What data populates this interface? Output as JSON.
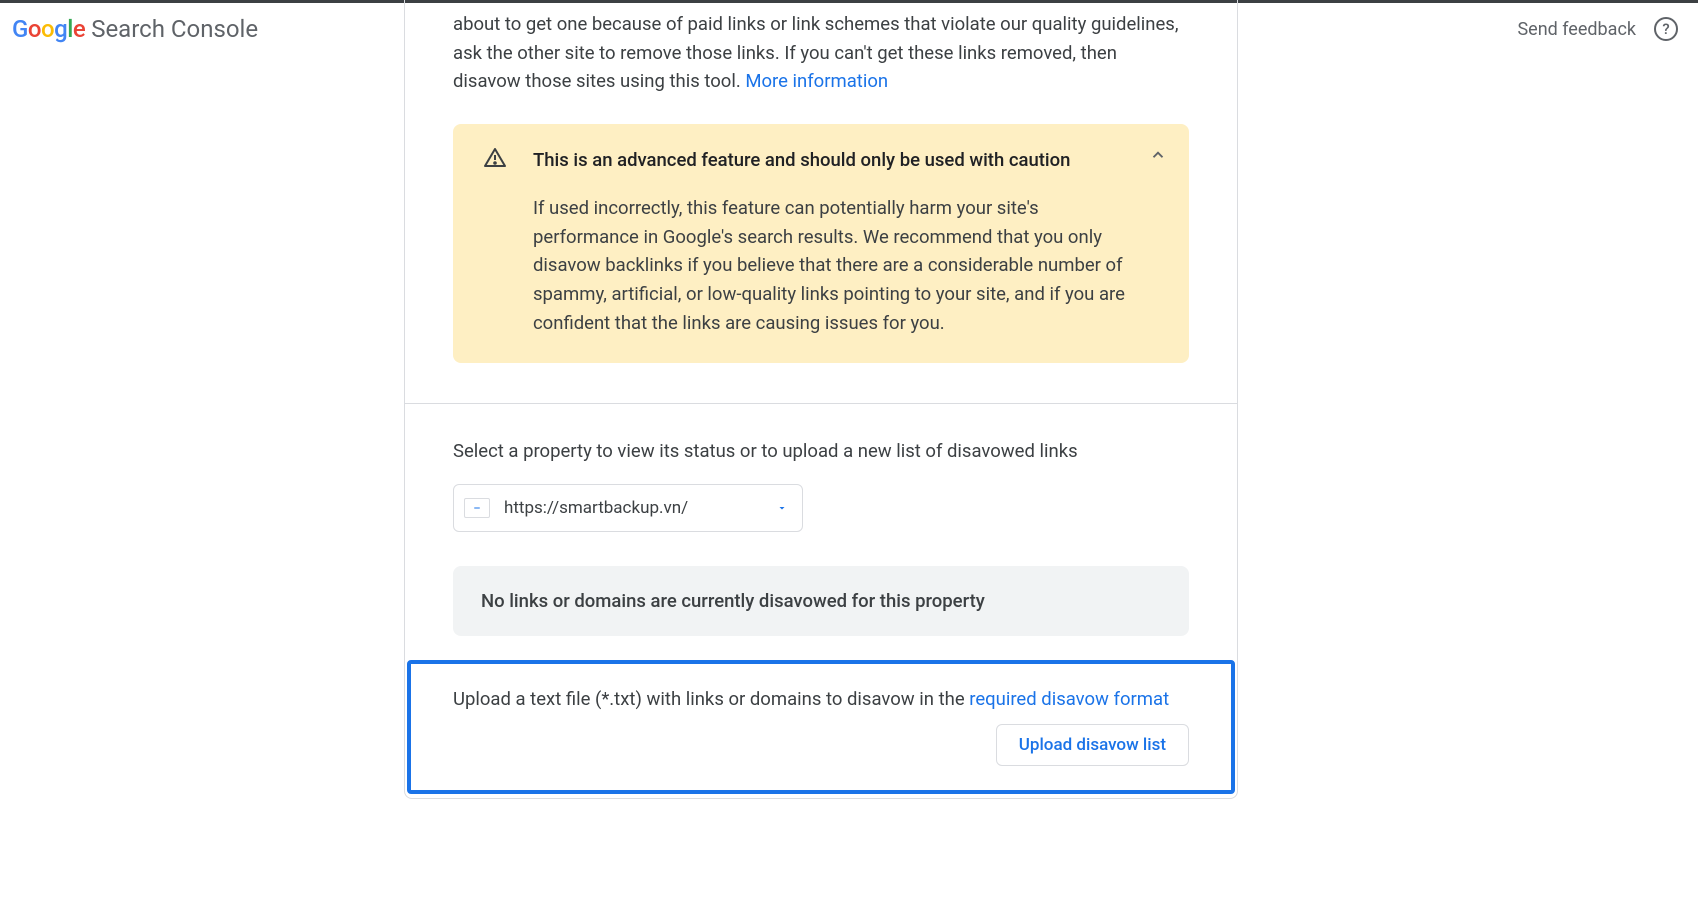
{
  "header": {
    "logo_product": "Search Console",
    "send_feedback": "Send feedback"
  },
  "intro": {
    "text_fragment": "about to get one because of paid links or link schemes that violate our quality guidelines, ask the other site to remove those links. If you can't get these links removed, then disavow those sites using this tool. ",
    "more_info_link": "More information"
  },
  "warning": {
    "title": "This is an advanced feature and should only be used with caution",
    "body": "If used incorrectly, this feature can potentially harm your site's performance in Google's search results. We recommend that you only disavow backlinks if you believe that there are a considerable number of spammy, artificial, or low-quality links pointing to your site, and if you are confident that the links are causing issues for you."
  },
  "property": {
    "label": "Select a property to view its status or to upload a new list of disavowed links",
    "selected": "https://smartbackup.vn/"
  },
  "status": {
    "message": "No links or domains are currently disavowed for this property"
  },
  "upload": {
    "text": "Upload a text file (*.txt) with links or domains to disavow in the ",
    "format_link": "required disavow format",
    "button": "Upload disavow list"
  }
}
